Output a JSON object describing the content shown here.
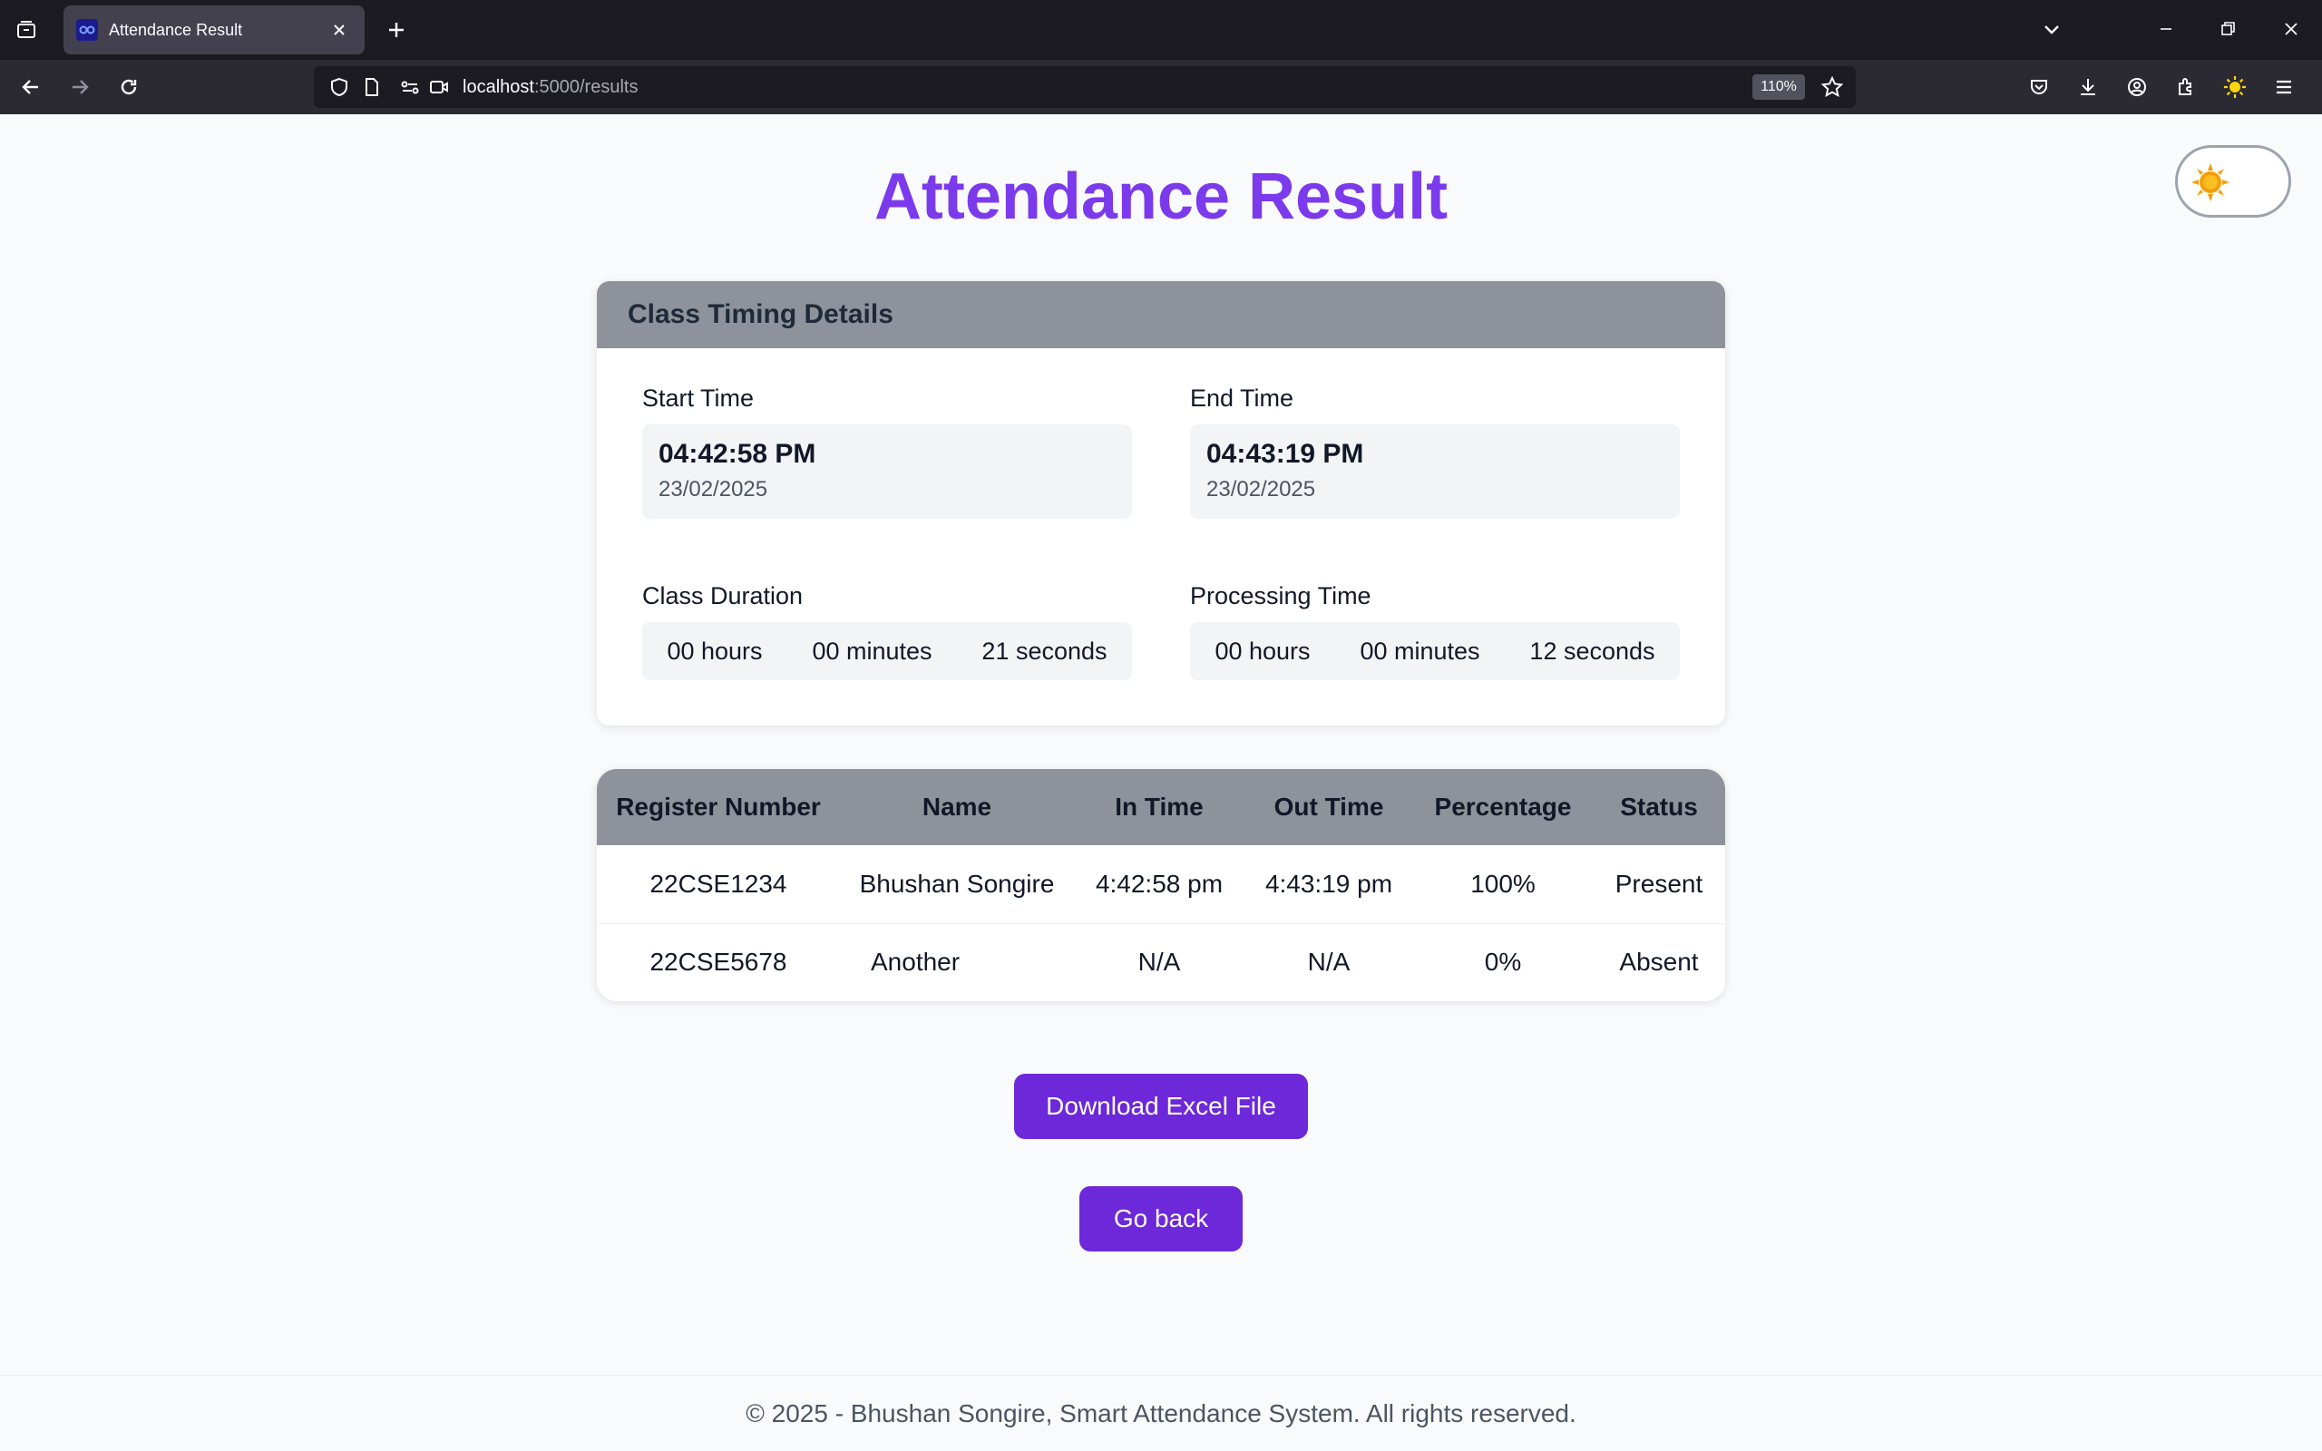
{
  "browser": {
    "tab_title": "Attendance Result",
    "url_host": "localhost",
    "url_path": ":5000/results",
    "zoom": "110%"
  },
  "page": {
    "title": "Attendance Result",
    "timing_card": {
      "header": "Class Timing Details",
      "start_label": "Start Time",
      "start_time": "04:42:58 PM",
      "start_date": "23/02/2025",
      "end_label": "End Time",
      "end_time": "04:43:19 PM",
      "end_date": "23/02/2025",
      "duration_label": "Class Duration",
      "duration": {
        "hours": "00 hours",
        "minutes": "00 minutes",
        "seconds": "21 seconds"
      },
      "processing_label": "Processing Time",
      "processing": {
        "hours": "00 hours",
        "minutes": "00 minutes",
        "seconds": "12 seconds"
      }
    },
    "table": {
      "headers": [
        "Register Number",
        "Name",
        "In Time",
        "Out Time",
        "Percentage",
        "Status"
      ],
      "rows": [
        [
          "22CSE1234",
          "Bhushan Songire",
          "4:42:58 pm",
          "4:43:19 pm",
          "100%",
          "Present"
        ],
        [
          "22CSE5678",
          "Another",
          "N/A",
          "N/A",
          "0%",
          "Absent"
        ]
      ]
    },
    "download_button": "Download Excel File",
    "back_button": "Go back",
    "footer": "© 2025 - Bhushan Songire, Smart Attendance System. All rights reserved."
  },
  "colors": {
    "accent": "#7c3aed",
    "button": "#6d28d9",
    "header_gray": "#8e939b"
  }
}
